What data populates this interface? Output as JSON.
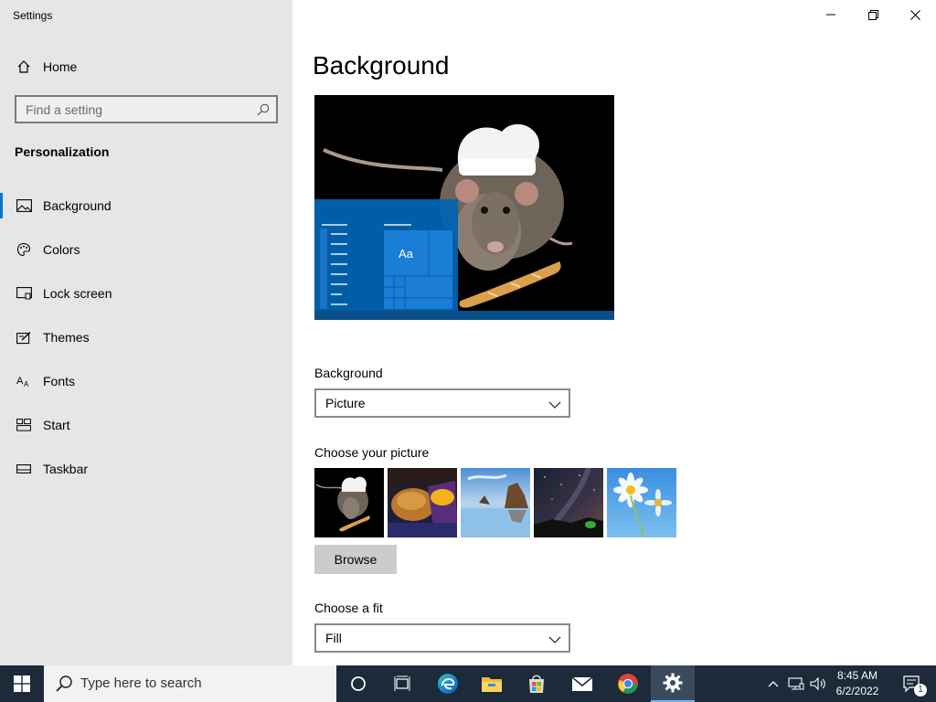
{
  "app": {
    "title": "Settings"
  },
  "sidebar": {
    "home_label": "Home",
    "search_placeholder": "Find a setting",
    "section_title": "Personalization",
    "items": [
      {
        "label": "Background",
        "icon": "picture-icon",
        "active": true
      },
      {
        "label": "Colors",
        "icon": "palette-icon",
        "active": false
      },
      {
        "label": "Lock screen",
        "icon": "lock-screen-icon",
        "active": false
      },
      {
        "label": "Themes",
        "icon": "themes-icon",
        "active": false
      },
      {
        "label": "Fonts",
        "icon": "fonts-icon",
        "active": false
      },
      {
        "label": "Start",
        "icon": "start-icon",
        "active": false
      },
      {
        "label": "Taskbar",
        "icon": "taskbar-icon",
        "active": false
      }
    ]
  },
  "main": {
    "title": "Background",
    "preview": {
      "tile_label": "Aa"
    },
    "background_label": "Background",
    "background_value": "Picture",
    "choose_picture_label": "Choose your picture",
    "thumbnails": [
      "rat-chef",
      "cheetos-snack",
      "coastal-rocks",
      "night-sky",
      "daisies"
    ],
    "browse_label": "Browse",
    "fit_label": "Choose a fit",
    "fit_value": "Fill"
  },
  "taskbar": {
    "search_placeholder": "Type here to search",
    "time": "8:45 AM",
    "date": "6/2/2022",
    "notification_count": "1"
  },
  "colors": {
    "accent": "#0078d4",
    "sidebar_bg": "#e6e6e6",
    "taskbar_bg": "#1c2a3a",
    "preview_blue": "#0063b1"
  }
}
